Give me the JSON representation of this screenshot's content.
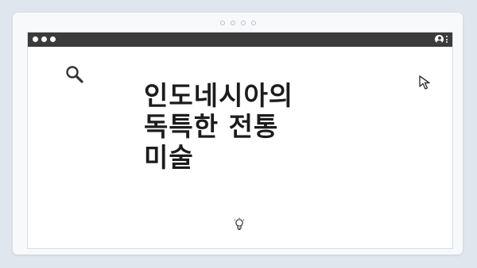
{
  "headline": {
    "line1": "인도네시아의",
    "line2": "독특한 전통",
    "line3": "미술"
  },
  "icons": {
    "search": "search-icon",
    "cursor": "cursor-arrow-icon",
    "bulb": "lightbulb-icon",
    "user": "user-account-icon",
    "menu": "kebab-menu-icon"
  },
  "colors": {
    "background": "#dfe6ee",
    "titlebar": "#3b3b3b",
    "headline": "#1c1c1c"
  }
}
